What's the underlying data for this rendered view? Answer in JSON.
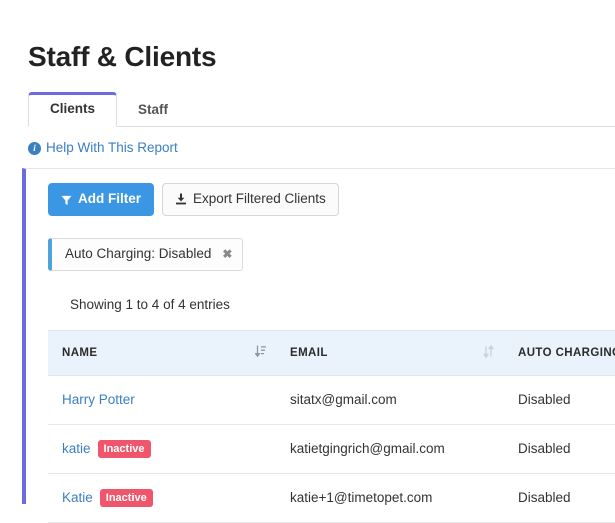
{
  "page": {
    "title": "Staff & Clients"
  },
  "tabs": [
    {
      "label": "Clients",
      "active": true
    },
    {
      "label": "Staff",
      "active": false
    }
  ],
  "help": {
    "icon": "info-circle-icon",
    "label": "Help With This Report"
  },
  "toolbar": {
    "add_filter_label": "Add Filter",
    "add_filter_icon": "filter-funnel-icon",
    "export_label": "Export Filtered Clients",
    "export_icon": "download-icon",
    "primary_color": "#3b97e3"
  },
  "active_filters": [
    {
      "label": "Auto Charging: Disabled",
      "remove_icon": "close-x-icon",
      "accent_color": "#4fa3dd"
    }
  ],
  "summary": {
    "showing_text": "Showing 1 to 4 of 4 entries"
  },
  "table": {
    "columns": [
      {
        "label": "NAME",
        "sort": "asc",
        "sort_icon": "sort-amount-asc-icon"
      },
      {
        "label": "EMAIL",
        "sort": "none",
        "sort_icon": "sort-updown-icon"
      },
      {
        "label": "AUTO CHARGING",
        "sort": "none",
        "sort_icon": ""
      }
    ],
    "header_background": "#eaf2fb",
    "rows": [
      {
        "name": "Harry Potter",
        "badge": "",
        "email": "sitatx@gmail.com",
        "auto_charging": "Disabled"
      },
      {
        "name": "katie",
        "badge": "Inactive",
        "email": "katietgingrich@gmail.com",
        "auto_charging": "Disabled"
      },
      {
        "name": "Katie",
        "badge": "Inactive",
        "email": "katie+1@timetopet.com",
        "auto_charging": "Disabled"
      }
    ],
    "badge_color": "#f0566b"
  },
  "theme": {
    "panel_accent": "#6b6be0",
    "link_color": "#3a7fc1"
  }
}
